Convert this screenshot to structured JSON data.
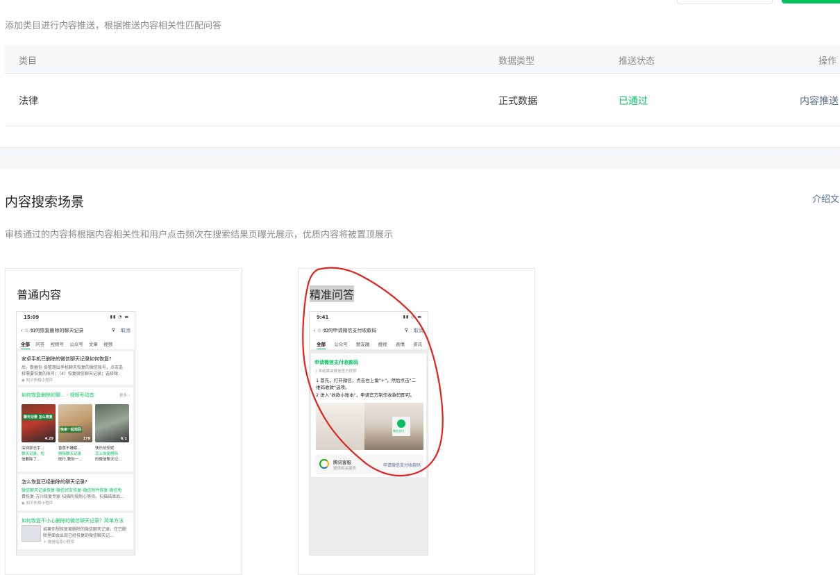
{
  "top": {
    "description": "添加类目进行内容推送，根据推送内容相关性匹配问答"
  },
  "table": {
    "headers": [
      "类目",
      "数据类型",
      "推送状态",
      "操作"
    ],
    "rows": [
      {
        "category": "法律",
        "data_type": "正式数据",
        "status": "已通过",
        "action": "内容推送"
      }
    ]
  },
  "search_scene": {
    "title": "内容搜索场景",
    "intro_link": "介绍文",
    "description": "审核通过的内容将根据内容相关性和用户点击频次在搜索结果页曝光展示，优质内容将被置顶展示"
  },
  "colors": {
    "accent": "#07c160",
    "link": "#576b95",
    "annotation": "#e4211d"
  },
  "cards": {
    "normal": {
      "title": "普通内容",
      "phone": {
        "time": "15:09",
        "query": "如何恢复删除的聊天记录",
        "cancel": "取消",
        "tabs": [
          "全部",
          "问答",
          "视频号",
          "公众号",
          "文章",
          "视频"
        ],
        "result1": {
          "title": "安卓手机已删除的微信聊天记录如何恢复?",
          "line1": "后，数据包 会整理出手机聊天恢复的微信账号，点击选",
          "line2": "择需要恢复的账号；（4）恢复微信聊天记录；选择微..",
          "source": "知乎热榜小程序"
        },
        "video_block": {
          "title": "如何恢复删除的聊... - 视频号动态",
          "more": "更多",
          "videos": [
            {
              "caption": "聊天记录 怎么恢复",
              "count": "4.29",
              "author": "深圳郭志宇...",
              "desc1": "聊天记录，短",
              "desc2": "信删除了..."
            },
            {
              "caption": "快来一起找回",
              "count": "179",
              "author": "香蕉不睡眠...",
              "desc1": "删除聊天记录",
              "desc2": "既行,教你一..."
            },
            {
              "caption": "",
              "count": "6.1",
              "author": "快乐的安妮",
              "desc1": "怎么恢复删除",
              "desc2": "的微信聊天记..."
            }
          ]
        },
        "result2": {
          "title": "怎么恢复已经删除的聊天记录?",
          "line1": "微信聊天记录恢复-微信好友恢复-微信附件恢复-微信免",
          "line2": "费恢复-万兴恢复专家 扫描阶段耐心等待。扫描结束后...",
          "source": "知乎热榜小程序"
        },
        "result3": {
          "title": "如何恢复不小心删除的微信聊天记录？简单方法",
          "line1": "如果你想恢复被删除的微信聊天记录，在已删",
          "line2": "除里面会出现已经恢复的微信聊天记...",
          "source": "微信指南小程序"
        }
      }
    },
    "precise": {
      "title": "精准问答",
      "phone": {
        "time": "9:41",
        "query": "如何申请微信支付收款码",
        "cancel": "取消",
        "tabs": [
          "全部",
          "公众号",
          "朋友圈",
          "搜视",
          "表情",
          "资讯"
        ],
        "answer_title": "申请微信支付收款码",
        "answer_source": "| 本结果由微信官方提供",
        "step1a": "1  首先，打开微信，点击右上角\"+\"，然后点击\"二",
        "step1b": "    维码收款\"选项。",
        "step2": "2  进入\"收款小账本\"，申请官方制作收款码即可。",
        "badge": "微信支付",
        "footer_name": "腾讯客服",
        "footer_sub": "提供相关服务",
        "footer_link": "申请微信支付收款码"
      }
    }
  }
}
